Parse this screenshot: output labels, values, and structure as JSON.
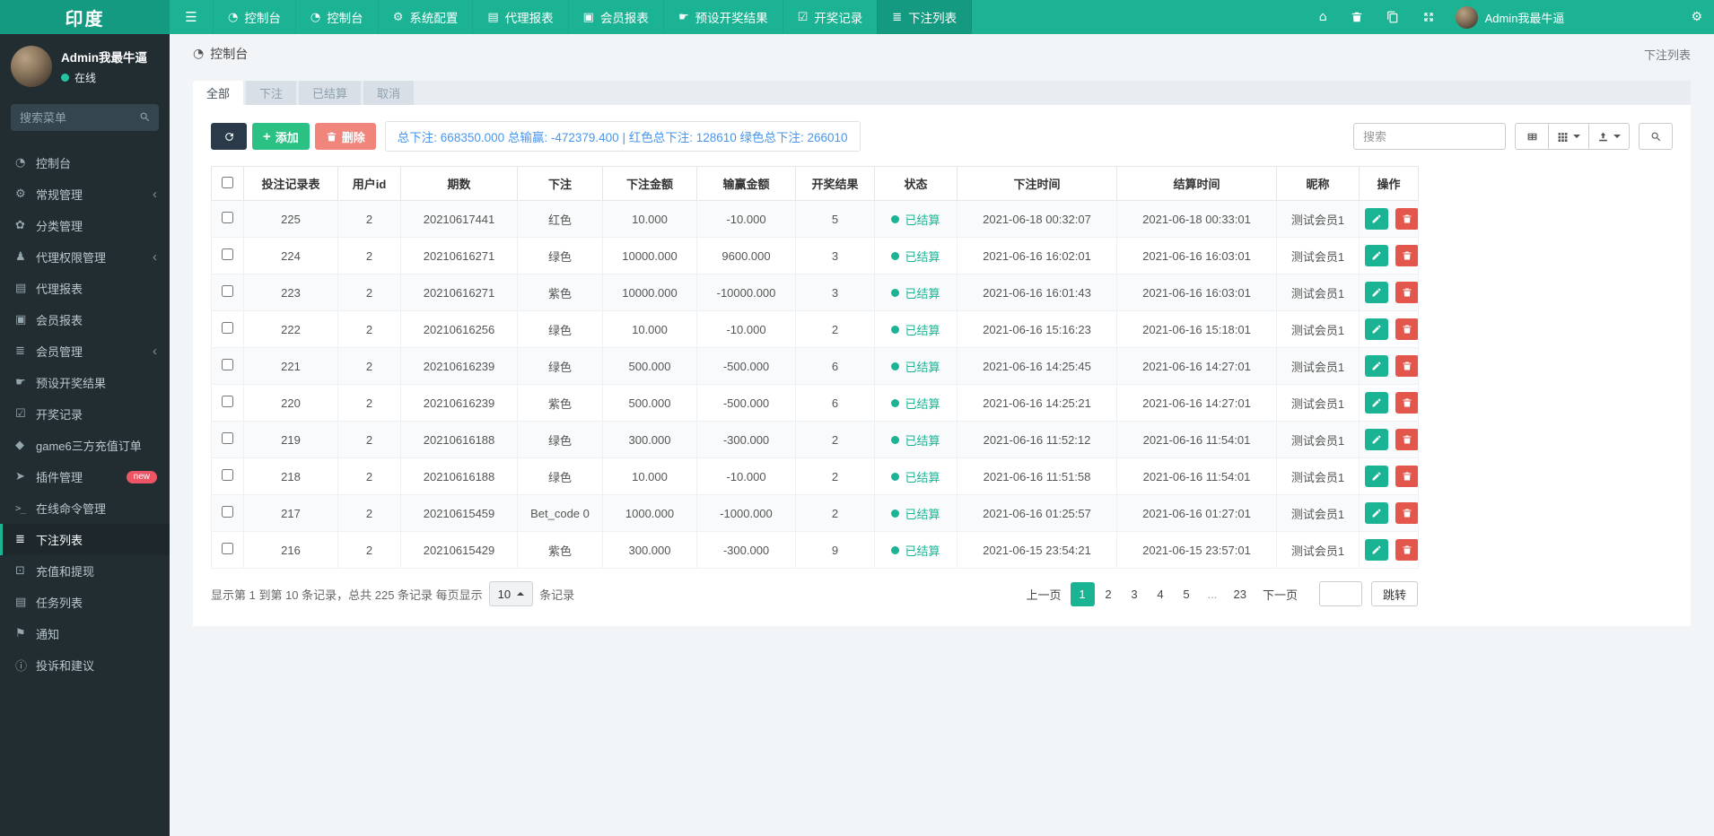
{
  "topbar": {
    "brand": "印度",
    "items": [
      {
        "label": "控制台",
        "icon": "dashboard",
        "active": false
      },
      {
        "label": "控制台",
        "icon": "dashboard",
        "active": false
      },
      {
        "label": "系统配置",
        "icon": "gear",
        "active": false
      },
      {
        "label": "代理报表",
        "icon": "book",
        "active": false
      },
      {
        "label": "会员报表",
        "icon": "id-card",
        "active": false
      },
      {
        "label": "预设开奖结果",
        "icon": "hand",
        "active": false
      },
      {
        "label": "开奖记录",
        "icon": "calendar",
        "active": false
      },
      {
        "label": "下注列表",
        "icon": "list",
        "active": true
      }
    ],
    "user_name": "Admin我最牛逼"
  },
  "sidebar": {
    "user": {
      "name": "Admin我最牛逼",
      "status": "在线"
    },
    "search_placeholder": "搜索菜单",
    "items": [
      {
        "label": "控制台",
        "icon": "dashboard",
        "active": false,
        "expandable": false,
        "badge": ""
      },
      {
        "label": "常规管理",
        "icon": "gears",
        "active": false,
        "expandable": true,
        "badge": ""
      },
      {
        "label": "分类管理",
        "icon": "leaf",
        "active": false,
        "expandable": false,
        "badge": ""
      },
      {
        "label": "代理权限管理",
        "icon": "users",
        "active": false,
        "expandable": true,
        "badge": ""
      },
      {
        "label": "代理报表",
        "icon": "book",
        "active": false,
        "expandable": false,
        "badge": ""
      },
      {
        "label": "会员报表",
        "icon": "id-card",
        "active": false,
        "expandable": false,
        "badge": ""
      },
      {
        "label": "会员管理",
        "icon": "list",
        "active": false,
        "expandable": true,
        "badge": ""
      },
      {
        "label": "预设开奖结果",
        "icon": "hand",
        "active": false,
        "expandable": false,
        "badge": ""
      },
      {
        "label": "开奖记录",
        "icon": "calendar",
        "active": false,
        "expandable": false,
        "badge": ""
      },
      {
        "label": "game6三方充值订单",
        "icon": "gem",
        "active": false,
        "expandable": false,
        "badge": ""
      },
      {
        "label": "插件管理",
        "icon": "plane",
        "active": false,
        "expandable": false,
        "badge": "new"
      },
      {
        "label": "在线命令管理",
        "icon": "terminal",
        "active": false,
        "expandable": false,
        "badge": ""
      },
      {
        "label": "下注列表",
        "icon": "list",
        "active": true,
        "expandable": false,
        "badge": ""
      },
      {
        "label": "充值和提现",
        "icon": "money",
        "active": false,
        "expandable": false,
        "badge": ""
      },
      {
        "label": "任务列表",
        "icon": "book",
        "active": false,
        "expandable": false,
        "badge": ""
      },
      {
        "label": "通知",
        "icon": "flag",
        "active": false,
        "expandable": false,
        "badge": ""
      },
      {
        "label": "投诉和建议",
        "icon": "info",
        "active": false,
        "expandable": false,
        "badge": ""
      }
    ]
  },
  "breadcrumb": {
    "left": "控制台",
    "right": "下注列表"
  },
  "tabs": {
    "items": [
      "全部",
      "下注",
      "已结算",
      "取消"
    ],
    "active_index": 0
  },
  "toolbar": {
    "add_label": "添加",
    "delete_label": "删除",
    "summary": "总下注: 668350.000 总输赢: -472379.400 | 红色总下注: 128610 绿色总下注: 266010",
    "search_placeholder": "搜索"
  },
  "table": {
    "columns": [
      "投注记录表",
      "用户id",
      "期数",
      "下注",
      "下注金额",
      "输赢金额",
      "开奖结果",
      "状态",
      "下注时间",
      "结算时间",
      "昵称",
      "操作"
    ],
    "rows": [
      {
        "id": "225",
        "uid": "2",
        "issue": "20210617441",
        "bet": "红色",
        "bet_style": "green",
        "amount": "10.000",
        "winloss": "-10.000",
        "result": "5",
        "status": "已结算",
        "bet_time": "2021-06-18 00:32:07",
        "settle_time": "2021-06-18 00:33:01",
        "nick": "测试会员1"
      },
      {
        "id": "224",
        "uid": "2",
        "issue": "20210616271",
        "bet": "绿色",
        "bet_style": "plain",
        "amount": "10000.000",
        "winloss": "9600.000",
        "result": "3",
        "status": "已结算",
        "bet_time": "2021-06-16 16:02:01",
        "settle_time": "2021-06-16 16:03:01",
        "nick": "测试会员1"
      },
      {
        "id": "223",
        "uid": "2",
        "issue": "20210616271",
        "bet": "紫色",
        "bet_style": "teal",
        "amount": "10000.000",
        "winloss": "-10000.000",
        "result": "3",
        "status": "已结算",
        "bet_time": "2021-06-16 16:01:43",
        "settle_time": "2021-06-16 16:03:01",
        "nick": "测试会员1"
      },
      {
        "id": "222",
        "uid": "2",
        "issue": "20210616256",
        "bet": "绿色",
        "bet_style": "plain",
        "amount": "10.000",
        "winloss": "-10.000",
        "result": "2",
        "status": "已结算",
        "bet_time": "2021-06-16 15:16:23",
        "settle_time": "2021-06-16 15:18:01",
        "nick": "测试会员1"
      },
      {
        "id": "221",
        "uid": "2",
        "issue": "20210616239",
        "bet": "绿色",
        "bet_style": "plain",
        "amount": "500.000",
        "winloss": "-500.000",
        "result": "6",
        "status": "已结算",
        "bet_time": "2021-06-16 14:25:45",
        "settle_time": "2021-06-16 14:27:01",
        "nick": "测试会员1"
      },
      {
        "id": "220",
        "uid": "2",
        "issue": "20210616239",
        "bet": "紫色",
        "bet_style": "teal",
        "amount": "500.000",
        "winloss": "-500.000",
        "result": "6",
        "status": "已结算",
        "bet_time": "2021-06-16 14:25:21",
        "settle_time": "2021-06-16 14:27:01",
        "nick": "测试会员1"
      },
      {
        "id": "219",
        "uid": "2",
        "issue": "20210616188",
        "bet": "绿色",
        "bet_style": "plain",
        "amount": "300.000",
        "winloss": "-300.000",
        "result": "2",
        "status": "已结算",
        "bet_time": "2021-06-16 11:52:12",
        "settle_time": "2021-06-16 11:54:01",
        "nick": "测试会员1"
      },
      {
        "id": "218",
        "uid": "2",
        "issue": "20210616188",
        "bet": "绿色",
        "bet_style": "plain",
        "amount": "10.000",
        "winloss": "-10.000",
        "result": "2",
        "status": "已结算",
        "bet_time": "2021-06-16 11:51:58",
        "settle_time": "2021-06-16 11:54:01",
        "nick": "测试会员1"
      },
      {
        "id": "217",
        "uid": "2",
        "issue": "20210615459",
        "bet": "Bet_code 0",
        "bet_style": "plain",
        "amount": "1000.000",
        "winloss": "-1000.000",
        "result": "2",
        "status": "已结算",
        "bet_time": "2021-06-16 01:25:57",
        "settle_time": "2021-06-16 01:27:01",
        "nick": "测试会员1"
      },
      {
        "id": "216",
        "uid": "2",
        "issue": "20210615429",
        "bet": "紫色",
        "bet_style": "teal",
        "amount": "300.000",
        "winloss": "-300.000",
        "result": "9",
        "status": "已结算",
        "bet_time": "2021-06-15 23:54:21",
        "settle_time": "2021-06-15 23:57:01",
        "nick": "测试会员1"
      }
    ]
  },
  "footer": {
    "info_prefix": "显示第 1 到第 10 条记录，总共 225 条记录 每页显示",
    "per_page": "10",
    "info_suffix": "条记录",
    "pagination": {
      "prev": "上一页",
      "pages": [
        "1",
        "2",
        "3",
        "4",
        "5",
        "...",
        "23"
      ],
      "active": "1",
      "next": "下一页",
      "jump_label": "跳转"
    }
  },
  "colors": {
    "accent_teal": "#1ab394",
    "topbar": "#1bb394",
    "sidebar": "#222d32",
    "summary_blue": "#4796ec",
    "add_green": "#2bc185",
    "delete_salmon": "#f0857b",
    "row_delete_red": "#e3564c",
    "badge_red": "#ed5565",
    "bet_green_text": "#38b87c",
    "bet_teal_text": "#7cdbca"
  }
}
